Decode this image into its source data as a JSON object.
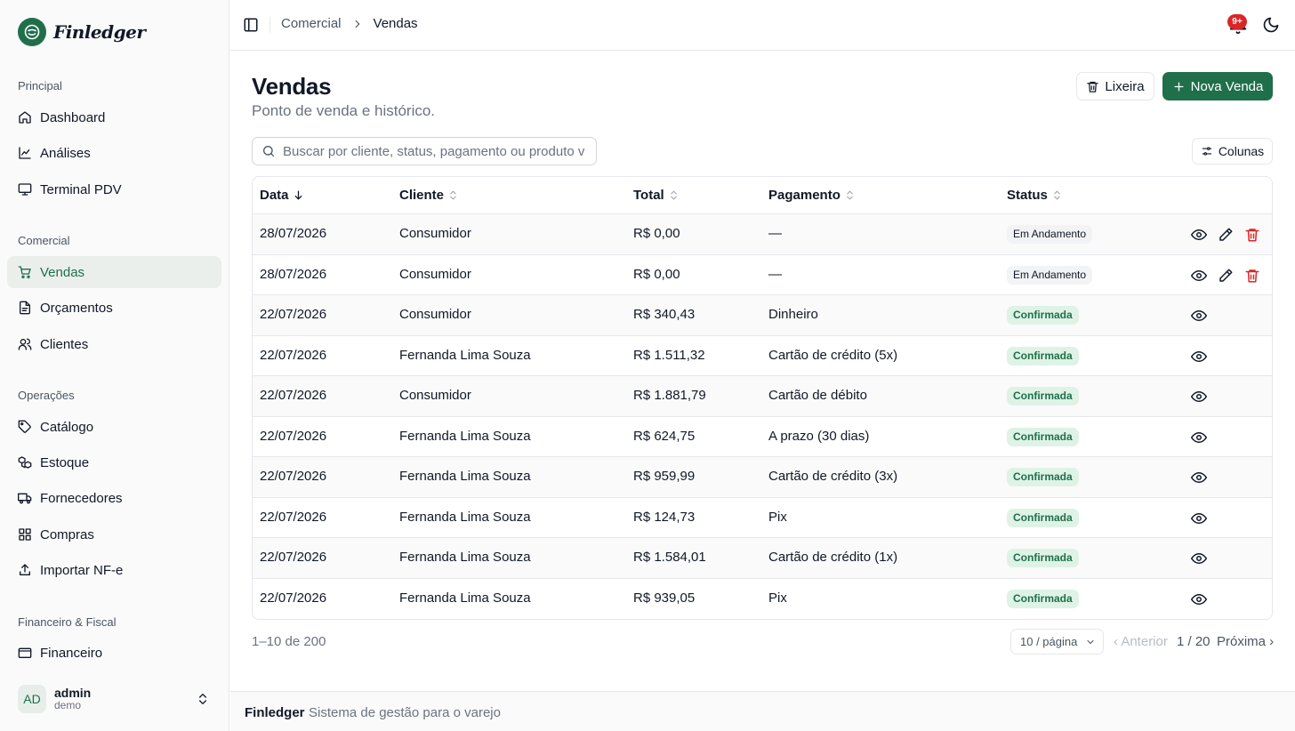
{
  "app": {
    "name": "Finledger"
  },
  "colors": {
    "accent": "#1f6f4a",
    "danger": "#dc2626",
    "active_bg": "#eaefec"
  },
  "sidebar": {
    "groups": [
      {
        "label": "Principal",
        "items": [
          {
            "label": "Dashboard",
            "icon": "home-icon"
          },
          {
            "label": "Análises",
            "icon": "chart-line-icon"
          },
          {
            "label": "Terminal PDV",
            "icon": "monitor-icon"
          }
        ]
      },
      {
        "label": "Comercial",
        "items": [
          {
            "label": "Vendas",
            "icon": "cart-icon",
            "active": true
          },
          {
            "label": "Orçamentos",
            "icon": "document-icon"
          },
          {
            "label": "Clientes",
            "icon": "users-icon"
          }
        ]
      },
      {
        "label": "Operações",
        "items": [
          {
            "label": "Catálogo",
            "icon": "tag-icon"
          },
          {
            "label": "Estoque",
            "icon": "boxes-icon"
          },
          {
            "label": "Fornecedores",
            "icon": "truck-icon"
          },
          {
            "label": "Compras",
            "icon": "grid-icon"
          },
          {
            "label": "Importar NF-e",
            "icon": "upload-icon"
          }
        ]
      },
      {
        "label": "Financeiro & Fiscal",
        "items": [
          {
            "label": "Financeiro",
            "icon": "wallet-icon"
          }
        ]
      }
    ],
    "user": {
      "initials": "AD",
      "name": "admin",
      "role": "demo"
    }
  },
  "topbar": {
    "breadcrumb": [
      "Comercial",
      "Vendas"
    ],
    "notifications_badge": "9+"
  },
  "page": {
    "title": "Vendas",
    "subtitle": "Ponto de venda e histórico.",
    "trash_label": "Lixeira",
    "new_label": "Nova Venda",
    "search_placeholder": "Buscar por cliente, status, pagamento ou produto vendido",
    "columns_label": "Colunas"
  },
  "table": {
    "headers": [
      "Data",
      "Cliente",
      "Total",
      "Pagamento",
      "Status"
    ],
    "rows": [
      {
        "date": "28/07/2026",
        "client": "Consumidor",
        "total": "R$ 0,00",
        "payment": "—",
        "status": "Em Andamento",
        "editable": true
      },
      {
        "date": "28/07/2026",
        "client": "Consumidor",
        "total": "R$ 0,00",
        "payment": "—",
        "status": "Em Andamento",
        "editable": true
      },
      {
        "date": "22/07/2026",
        "client": "Consumidor",
        "total": "R$ 340,43",
        "payment": "Dinheiro",
        "status": "Confirmada",
        "editable": false
      },
      {
        "date": "22/07/2026",
        "client": "Fernanda Lima Souza",
        "total": "R$ 1.511,32",
        "payment": "Cartão de crédito (5x)",
        "status": "Confirmada",
        "editable": false
      },
      {
        "date": "22/07/2026",
        "client": "Consumidor",
        "total": "R$ 1.881,79",
        "payment": "Cartão de débito",
        "status": "Confirmada",
        "editable": false
      },
      {
        "date": "22/07/2026",
        "client": "Fernanda Lima Souza",
        "total": "R$ 624,75",
        "payment": "A prazo (30 dias)",
        "status": "Confirmada",
        "editable": false
      },
      {
        "date": "22/07/2026",
        "client": "Fernanda Lima Souza",
        "total": "R$ 959,99",
        "payment": "Cartão de crédito (3x)",
        "status": "Confirmada",
        "editable": false
      },
      {
        "date": "22/07/2026",
        "client": "Fernanda Lima Souza",
        "total": "R$ 124,73",
        "payment": "Pix",
        "status": "Confirmada",
        "editable": false
      },
      {
        "date": "22/07/2026",
        "client": "Fernanda Lima Souza",
        "total": "R$ 1.584,01",
        "payment": "Cartão de crédito (1x)",
        "status": "Confirmada",
        "editable": false
      },
      {
        "date": "22/07/2026",
        "client": "Fernanda Lima Souza",
        "total": "R$ 939,05",
        "payment": "Pix",
        "status": "Confirmada",
        "editable": false
      }
    ]
  },
  "pagination": {
    "info": "1–10 de 200",
    "per_page": "10 / página",
    "prev": "‹ Anterior",
    "page": "1 / 20",
    "next": "Próxima ›"
  },
  "footer": {
    "brand": "Finledger",
    "text": "Sistema de gestão para o varejo"
  }
}
